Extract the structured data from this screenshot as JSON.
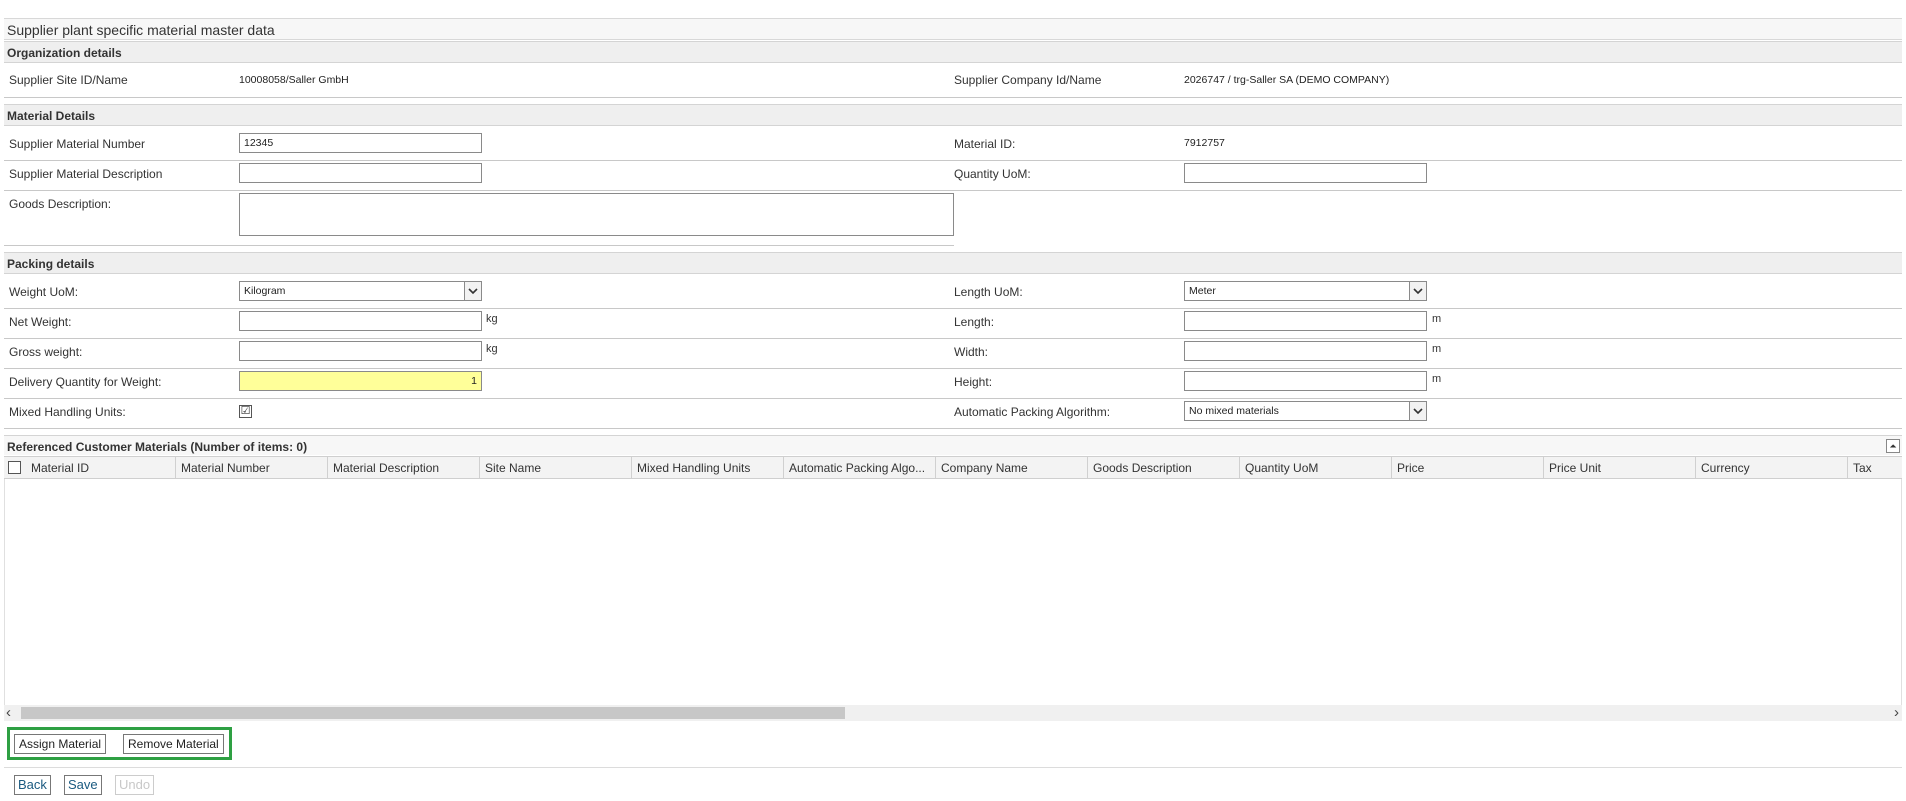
{
  "page": {
    "title": "Supplier plant specific material master data"
  },
  "org": {
    "header": "Organization details",
    "site_label": "Supplier Site ID/Name",
    "site_value": "10008058/Saller GmbH",
    "company_label": "Supplier Company Id/Name",
    "company_value": "2026747 / trg-Saller SA (DEMO COMPANY)"
  },
  "material": {
    "header": "Material Details",
    "number_label": "Supplier Material Number",
    "number_value": "12345",
    "id_label": "Material ID:",
    "id_value": "7912757",
    "desc_label": "Supplier Material Description",
    "desc_value": "",
    "qty_uom_label": "Quantity UoM:",
    "qty_uom_value": "",
    "goods_label": "Goods Description:",
    "goods_value": ""
  },
  "packing": {
    "header": "Packing details",
    "weight_uom_label": "Weight UoM:",
    "weight_uom_value": "Kilogram",
    "length_uom_label": "Length UoM:",
    "length_uom_value": "Meter",
    "net_weight_label": "Net Weight:",
    "net_weight_value": "",
    "net_weight_unit": "kg",
    "length_label": "Length:",
    "length_value": "",
    "length_unit": "m",
    "gross_weight_label": "Gross weight:",
    "gross_weight_value": "",
    "gross_weight_unit": "kg",
    "width_label": "Width:",
    "width_value": "",
    "width_unit": "m",
    "delivery_qty_label": "Delivery Quantity for Weight:",
    "delivery_qty_value": "1",
    "height_label": "Height:",
    "height_value": "",
    "height_unit": "m",
    "mixed_label": "Mixed Handling Units:",
    "mixed_checked": "☑",
    "algo_label": "Automatic Packing Algorithm:",
    "algo_value": "No mixed materials",
    "highlight_color": "#ffff99"
  },
  "referenced": {
    "header": "Referenced Customer Materials (Number of items: 0)",
    "collapse_glyph": "⏶",
    "columns": [
      "Material ID",
      "Material Number",
      "Material Description",
      "Site Name",
      "Mixed Handling Units",
      "Automatic Packing Algo...",
      "Company Name",
      "Goods Description",
      "Quantity UoM",
      "Price",
      "Price Unit",
      "Currency",
      "Tax"
    ]
  },
  "scroll": {
    "left_glyph": "‹",
    "right_glyph": "›"
  },
  "actions": {
    "assign": "Assign Material",
    "remove": "Remove Material",
    "highlight_color": "#2ea043"
  },
  "footer": {
    "back": "Back",
    "save": "Save",
    "undo": "Undo"
  },
  "icons": {
    "dropdown": "chevron-down-icon",
    "checkbox": "checkbox-icon",
    "collapse": "collapse-icon"
  }
}
